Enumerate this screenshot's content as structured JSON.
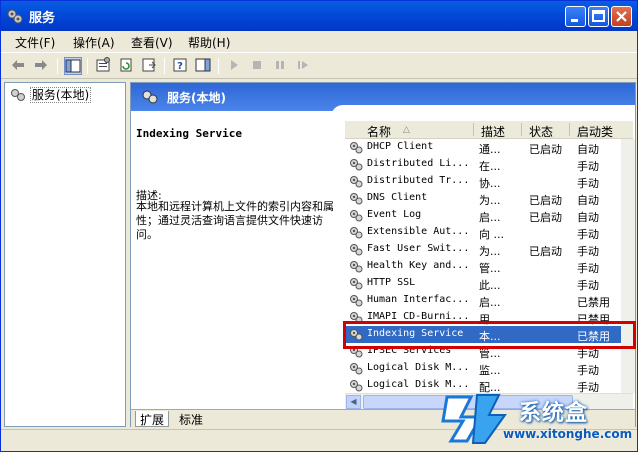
{
  "window": {
    "title": "服务"
  },
  "menubar": {
    "items": [
      "文件(F)",
      "操作(A)",
      "查看(V)",
      "帮助(H)"
    ]
  },
  "tree": {
    "root_label": "服务(本地)"
  },
  "right_pane": {
    "header": "服务(本地)",
    "description": {
      "title": "Indexing Service",
      "label": "描述:",
      "text": "本地和远程计算机上文件的索引内容和属性；通过灵活查询语言提供文件快速访问。"
    },
    "columns": {
      "name": "名称",
      "sort_arrow": "△",
      "desc": "描述",
      "status": "状态",
      "startup": "启动类"
    },
    "services": [
      {
        "name": "DHCP Client",
        "desc": "通...",
        "status": "已启动",
        "startup": "自动"
      },
      {
        "name": "Distributed Li...",
        "desc": "在...",
        "status": "",
        "startup": "手动"
      },
      {
        "name": "Distributed Tr...",
        "desc": "协...",
        "status": "",
        "startup": "手动"
      },
      {
        "name": "DNS Client",
        "desc": "为...",
        "status": "已启动",
        "startup": "自动"
      },
      {
        "name": "Event Log",
        "desc": "启...",
        "status": "已启动",
        "startup": "自动"
      },
      {
        "name": "Extensible Aut...",
        "desc": "向 ...",
        "status": "",
        "startup": "手动"
      },
      {
        "name": "Fast User Swit...",
        "desc": "为...",
        "status": "已启动",
        "startup": "手动"
      },
      {
        "name": "Health Key and...",
        "desc": "管...",
        "status": "",
        "startup": "手动"
      },
      {
        "name": "HTTP SSL",
        "desc": "此...",
        "status": "",
        "startup": "手动"
      },
      {
        "name": "Human Interfac...",
        "desc": "启...",
        "status": "",
        "startup": "已禁用"
      },
      {
        "name": "IMAPI CD-Burni...",
        "desc": "用...",
        "status": "",
        "startup": "已禁用"
      },
      {
        "name": "Indexing Service",
        "desc": "本...",
        "status": "",
        "startup": "已禁用"
      },
      {
        "name": "IPSEC Services",
        "desc": "管...",
        "status": "",
        "startup": "手动"
      },
      {
        "name": "Logical Disk M...",
        "desc": "监...",
        "status": "",
        "startup": "手动"
      },
      {
        "name": "Logical Disk M...",
        "desc": "配...",
        "status": "",
        "startup": "手动"
      }
    ],
    "selected_index": 11,
    "tabs": [
      "扩展",
      "标准"
    ]
  },
  "watermark": {
    "text": "系统盒",
    "url": "www.xitonghe.com"
  },
  "colors": {
    "title_blue": "#0249d7",
    "selection": "#316ac5",
    "highlight_red": "#d40000"
  }
}
